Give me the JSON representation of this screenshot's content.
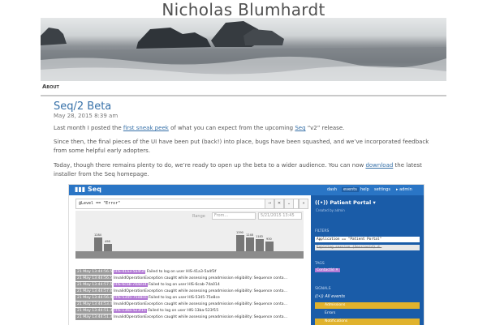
{
  "site": {
    "title": "Nicholas Blumhardt"
  },
  "nav": {
    "about": "About"
  },
  "post": {
    "title": "Seq/2 Beta",
    "date": "May 28, 2015 8:39 am",
    "p1": {
      "before": "Last month I posted the ",
      "link1": "first sneak peek",
      "middle": " of what you can expect from the upcoming ",
      "link2": "Seq",
      "after": " “v2” release."
    },
    "p2": "Since then, the final pieces of the UI have been put (back!) into place, bugs have been squashed, and we’ve incorporated feedback from some helpful early adopters.",
    "p3": {
      "before": "Today, though there remains plenty to do, we’re ready to open up the beta to a wider audience. You can now ",
      "link": "download",
      "after": " the latest installer from the Seq homepage."
    }
  },
  "seq": {
    "logo": "Seq",
    "nav": [
      "dash",
      "events",
      "help",
      "settings",
      "▸ admin"
    ],
    "query": "@Level == \"Error\"",
    "buttons": [
      "→",
      "✕",
      "⌄",
      "»"
    ],
    "range": {
      "label": "Range",
      "from": "From...",
      "to": "5/21/2015 13:45"
    },
    "bars": [
      "1284",
      "498",
      "1390",
      "1248",
      "1183",
      "930"
    ],
    "events": [
      {
        "ts": "21 May 13:44:56.536",
        "tokens": [
          {
            "text": "HIS-41a3-5a4f3f",
            "style": "purple"
          }
        ],
        "msg": "Failed to log on user HIS-41a3-5a4f3f"
      },
      {
        "ts": "21 May 13:44:56.531",
        "tokens": [],
        "msg": "InvalidOperationException caught while assessing preadmission eligibility: Sequence conta…"
      },
      {
        "ts": "21 May 13:44:57.587",
        "tokens": [
          {
            "text": "HIS-6cab-74a014",
            "style": "purple"
          }
        ],
        "msg": "Failed to log on user HIS-6cab-74a014"
      },
      {
        "ts": "21 May 13:44:57.673",
        "tokens": [],
        "msg": "InvalidOperationException caught while assessing preadmission eligibility: Sequence conta…"
      },
      {
        "ts": "21 May 13:44:56.460",
        "tokens": [
          {
            "text": "HIS-5345-75e8ce",
            "style": "purple"
          }
        ],
        "msg": "Failed to log on user HIS-5345-75e8ce"
      },
      {
        "ts": "21 May 13:44:53.408",
        "tokens": [],
        "msg": "InvalidOperationException caught while assessing preadmission eligibility: Sequence conta…"
      },
      {
        "ts": "21 May 13:44:51.360",
        "tokens": [
          {
            "text": "HIS-13ba-523f15",
            "style": "purple"
          }
        ],
        "msg": "Failed to log on user HIS-13ba-523f15"
      },
      {
        "ts": "21 May 13:44:51.357",
        "tokens": [],
        "msg": "InvalidOperationException caught while assessing preadmission eligibility: Sequence conta…"
      }
    ],
    "side": {
      "title": "Patient Portal ▾",
      "created": "Created by admin",
      "filters_h": "FILTERS",
      "filter1": "Application == \"Patient Portal\"",
      "filter2": "Expiring session (Sessionid) d…",
      "tags_h": "TAGS",
      "tag": "ContactId ✕",
      "signals_h": "SIGNALS",
      "all_events": "All events",
      "signals": [
        "Admissions",
        "Errors",
        "Notifications"
      ]
    }
  },
  "colors": {
    "seq_blue": "#2a75c5",
    "side_blue": "#1a5ca8",
    "link": "#3670a8",
    "signal": "#e0b22d"
  }
}
